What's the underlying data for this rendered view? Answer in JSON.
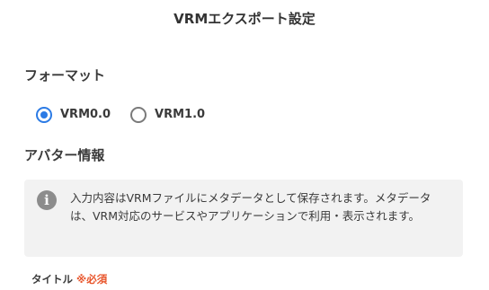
{
  "dialog": {
    "title": "VRMエクスポート設定"
  },
  "format_section": {
    "heading": "フォーマット",
    "options": [
      {
        "label": "VRM0.0",
        "selected": true
      },
      {
        "label": "VRM1.0",
        "selected": false
      }
    ]
  },
  "avatar_section": {
    "heading": "アバター情報",
    "info_icon": "info-icon",
    "info_text": "入力内容はVRMファイルにメタデータとして保存されます。メタデータは、VRM対応のサービスやアプリケーションで利用・表示されます。"
  },
  "title_field": {
    "label": "タイトル",
    "required_mark": "※必須"
  },
  "colors": {
    "accent": "#2c7be5",
    "required": "#e8542a",
    "info_box_bg": "#f2f2f2"
  }
}
